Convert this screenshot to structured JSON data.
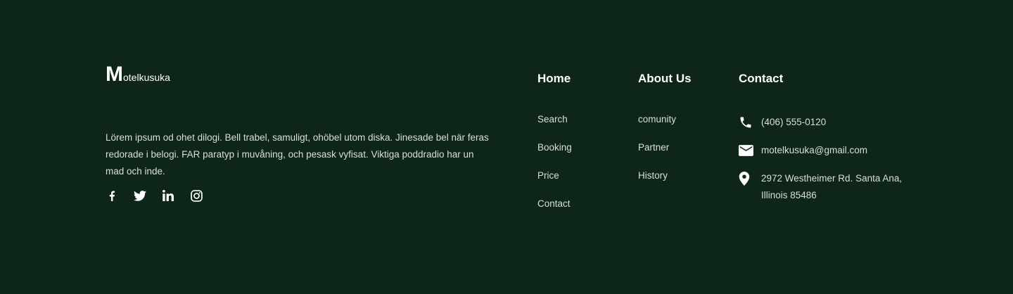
{
  "brand": {
    "initial": "M",
    "rest": "otelkusuka"
  },
  "about": {
    "text": "Lörem ipsum od ohet dilogi. Bell trabel, samuligt, ohöbel utom diska. Jinesade bel när feras redorade i belogi. FAR paratyp i muvåning, och pesask vyfisat. Viktiga poddradio har un mad och inde."
  },
  "social": [
    {
      "icon": "facebook-icon"
    },
    {
      "icon": "twitter-icon"
    },
    {
      "icon": "linkedin-icon"
    },
    {
      "icon": "instagram-icon"
    }
  ],
  "columns": {
    "home": {
      "title": "Home",
      "items": [
        "Search",
        "Booking",
        "Price",
        "Contact"
      ]
    },
    "about": {
      "title": "About Us",
      "items": [
        "comunity",
        "Partner",
        "History"
      ]
    },
    "contact": {
      "title": "Contact",
      "phone": "(406) 555-0120",
      "email": "motelkusuka@gmail.com",
      "address": "2972 Westheimer Rd. Santa Ana, Illinois 85486"
    }
  },
  "colors": {
    "background": "#0e2617",
    "text": "#ffffff",
    "muted": "#d9dfda"
  }
}
